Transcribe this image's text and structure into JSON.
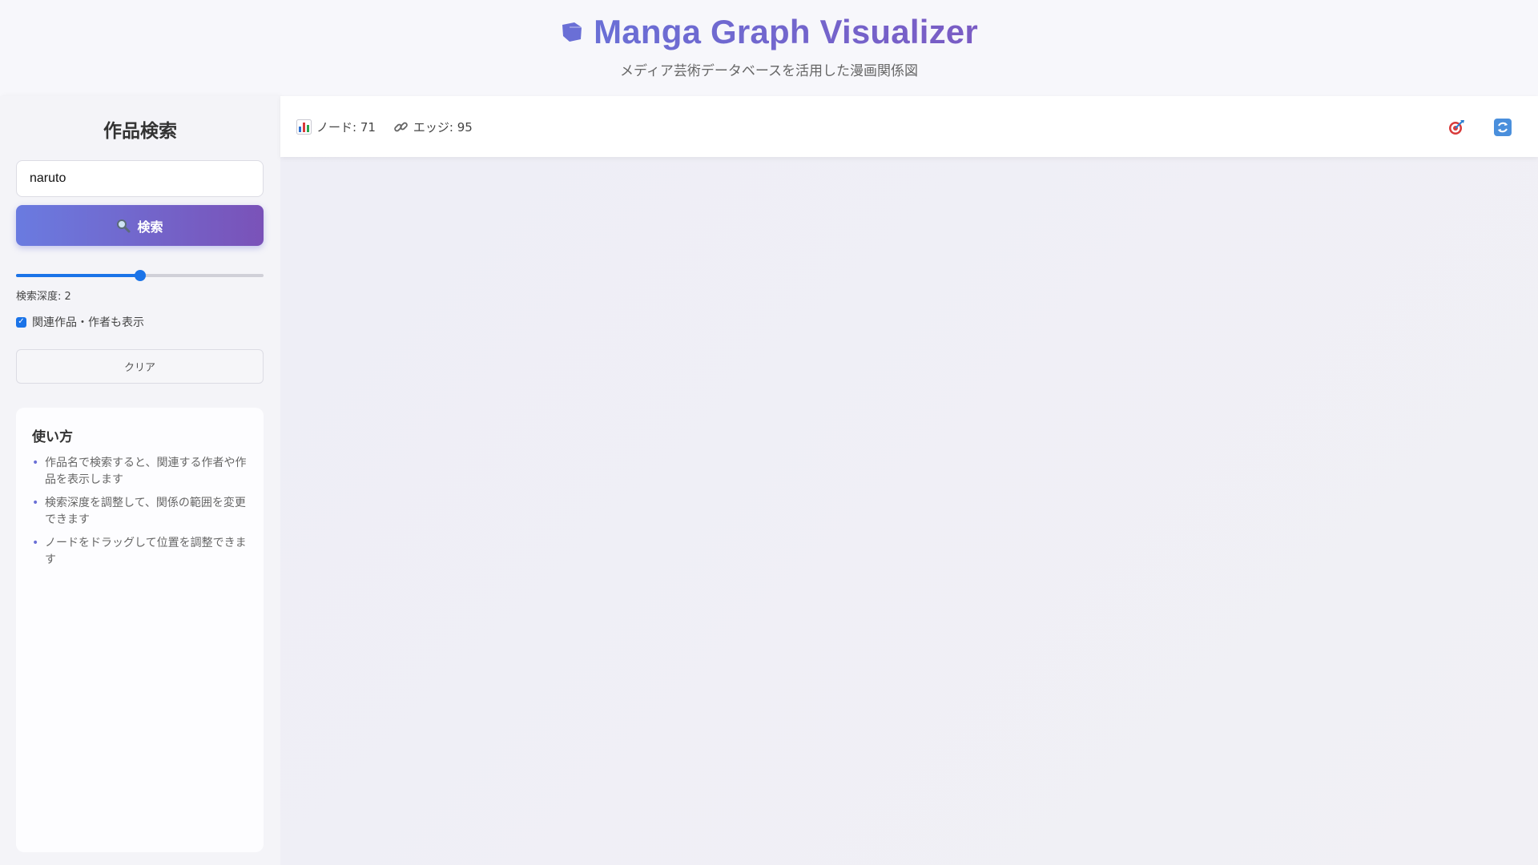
{
  "header": {
    "title": "Manga Graph Visualizer",
    "subtitle": "メディア芸術データベースを活用した漫画関係図",
    "title_icon": "book-icon"
  },
  "sidebar": {
    "title": "作品検索",
    "search": {
      "value": "naruto",
      "placeholder": ""
    },
    "search_button_label": "検索",
    "depth": {
      "value": 2,
      "min": 1,
      "max": 3,
      "label": "検索深度: 2"
    },
    "show_related": {
      "checked": true,
      "label": "関連作品・作者も表示"
    },
    "clear_label": "クリア",
    "help": {
      "title": "使い方",
      "items": [
        "作品名で検索すると、関連する作者や作品を表示します",
        "検索深度を調整して、関係の範囲を変更できます",
        "ノードをドラッグして位置を調整できます"
      ]
    }
  },
  "stats": {
    "nodes_label": "ノード: 71",
    "edges_label": "エッジ: 95"
  },
  "toolbar": {
    "center_icon": "target-icon",
    "reset_icon": "refresh-icon"
  },
  "colors": {
    "accent": "#6a6fd6",
    "slider": "#1a73e8"
  }
}
